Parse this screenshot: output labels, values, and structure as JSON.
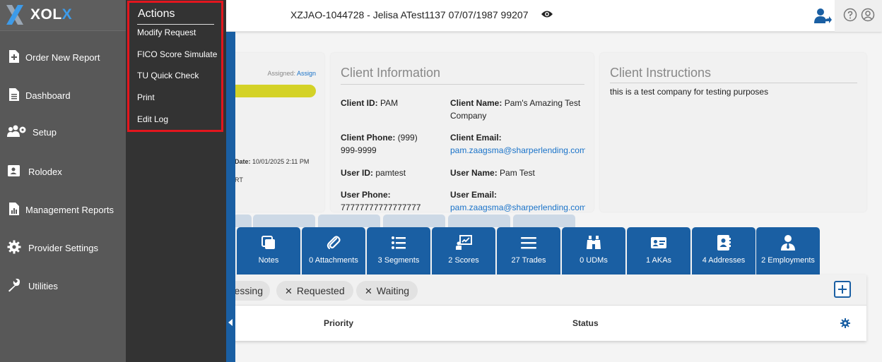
{
  "header": {
    "title": "XZJAO-1044728 - Jelisa ATest1137 07/07/1987 99207"
  },
  "logo": {
    "main": "XOL",
    "accent": "X"
  },
  "sidebar": {
    "items": [
      {
        "label": "Order New Report",
        "icon": "file-plus-icon"
      },
      {
        "label": "Dashboard",
        "icon": "document-icon"
      },
      {
        "label": "Setup",
        "icon": "users-gear-icon"
      },
      {
        "label": "Rolodex",
        "icon": "contact-card-icon"
      },
      {
        "label": "Management Reports",
        "icon": "report-chart-icon"
      },
      {
        "label": "Provider Settings",
        "icon": "gear-icon"
      },
      {
        "label": "Utilities",
        "icon": "wrench-icon"
      }
    ]
  },
  "actions": {
    "title": "Actions",
    "items": [
      "Modify Request",
      "FICO Score Simulate",
      "TU Quick Check",
      "Print",
      "Edit Log"
    ]
  },
  "order_card": {
    "assigned_label": "Assigned:",
    "assigned_link": "Assign",
    "date_label": "Date:",
    "date_value": "10/01/2025 2:11 PM",
    "rt_text": "RT"
  },
  "client_info": {
    "heading": "Client Information",
    "client_id_label": "Client ID:",
    "client_id": "PAM",
    "client_name_label": "Client Name:",
    "client_name": "Pam's Amazing Test Company",
    "client_phone_label": "Client Phone:",
    "client_phone": "(999) 999-9999",
    "client_email_label": "Client Email:",
    "client_email": "pam.zaagsma@sharperlending.com",
    "user_id_label": "User ID:",
    "user_id": "pamtest",
    "user_name_label": "User Name:",
    "user_name": "Pam Test",
    "user_phone_label": "User Phone:",
    "user_phone": "77777777777777777",
    "user_email_label": "User Email:",
    "user_email": "pam.zaagsma@sharperlending.com"
  },
  "client_instructions": {
    "heading": "Client Instructions",
    "text": "this is a test company for testing purposes"
  },
  "tabs": [
    {
      "label": "Notes",
      "icon": "notes-icon"
    },
    {
      "label": "0 Attachments",
      "icon": "paperclip-icon"
    },
    {
      "label": "3 Segments",
      "icon": "list-icon"
    },
    {
      "label": "2 Scores",
      "icon": "presentation-chart-icon"
    },
    {
      "label": "27 Trades",
      "icon": "lines-icon"
    },
    {
      "label": "0 UDMs",
      "icon": "binoculars-icon"
    },
    {
      "label": "1 AKAs",
      "icon": "id-card-icon"
    },
    {
      "label": "4 Addresses",
      "icon": "address-book-icon"
    },
    {
      "label": "2 Employments",
      "icon": "user-tie-icon"
    }
  ],
  "filters": {
    "chips": [
      "essing",
      "Requested",
      "Waiting"
    ]
  },
  "table": {
    "columns": [
      "Priority",
      "Status"
    ]
  },
  "colors": {
    "primary": "#1a5fa3",
    "sidebar": "#585858",
    "actions_bg": "#333333",
    "highlight": "#e3161e",
    "status_bar": "#d4d227",
    "link": "#1a73c9"
  }
}
